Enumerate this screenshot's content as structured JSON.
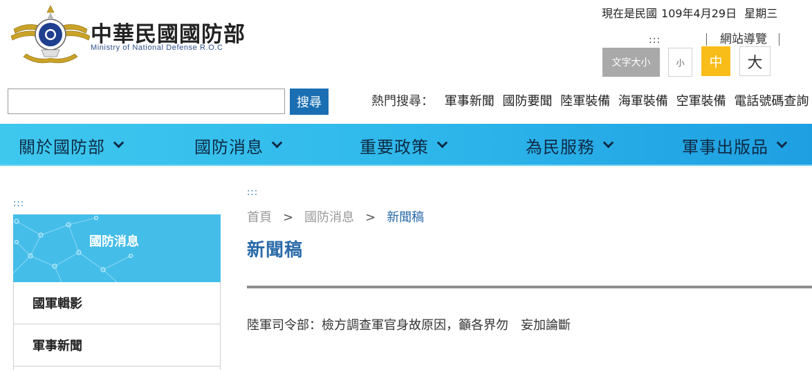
{
  "header": {
    "site_title": "中華民國國防部",
    "site_subtitle": "Ministry of National Defense R.O.C",
    "date": {
      "prefix": "現在是民國",
      "value": "109年4月29日",
      "weekday": "星期三"
    },
    "accesskey": ":::",
    "sitemap": "網站導覽",
    "font_size": {
      "label": "文字大小",
      "small": "小",
      "medium": "中",
      "large": "大",
      "active_color": "#f9bd1a"
    }
  },
  "search": {
    "input_value": "",
    "button": "搜尋"
  },
  "hot_search": {
    "label": "熱門搜尋：",
    "items": [
      "軍事新聞",
      "國防要聞",
      "陸軍裝備",
      "海軍裝備",
      "空軍裝備",
      "電話號碼查詢"
    ]
  },
  "nav": {
    "items": [
      "關於國防部",
      "國防消息",
      "重要政策",
      "為民服務",
      "軍事出版品"
    ],
    "color": "#2fb8eb"
  },
  "sidebar": {
    "accesskey": ":::",
    "header": "國防消息",
    "items": [
      "國軍輯影",
      "軍事新聞",
      ""
    ]
  },
  "main": {
    "accesskey": ":::",
    "breadcrumb": {
      "home": "首頁",
      "sep1": ">",
      "section": "國防消息",
      "sep2": ">",
      "current": "新聞稿"
    },
    "title": "新聞稿",
    "articles": [
      "陸軍司令部：檢方調查軍官身故原因，籲各界勿　妄加論斷"
    ]
  }
}
